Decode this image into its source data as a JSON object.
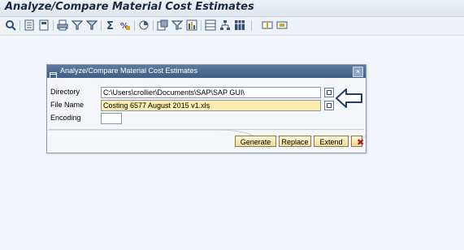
{
  "window": {
    "title": "Analyze/Compare Material Cost Estimates"
  },
  "toolbar": {
    "icons": [
      "display-icon",
      "detail-icon",
      "select-icon",
      "print-icon",
      "filter-icon",
      "set-filter-icon",
      "sum-icon",
      "subtotal-icon",
      "graphics-icon",
      "export-icon",
      "abc-analysis-icon",
      "column-icon",
      "layout-icon",
      "hierarchy-icon",
      "grid-icon",
      "split-icon",
      "merge-icon"
    ]
  },
  "dialog": {
    "title": "Analyze/Compare Material Cost Estimates",
    "close_symbol": "×",
    "fields": {
      "directory_label": "Directory",
      "directory_value": "C:\\Users\\crollier\\Documents\\SAP\\SAP GUI\\",
      "file_name_label": "File Name",
      "file_name_value": "Costing 6577 August 2015 v1.xls",
      "encoding_label": "Encoding",
      "encoding_value": ""
    },
    "buttons": {
      "generate": "Generate",
      "replace": "Replace",
      "extend": "Extend",
      "cancel_symbol": "✖"
    }
  },
  "colors": {
    "dialog_title": "#3f5f86",
    "required_field": "#fdeeb0",
    "cancel_red": "#c0131a",
    "arrow_outline": "#1d3d6b"
  }
}
